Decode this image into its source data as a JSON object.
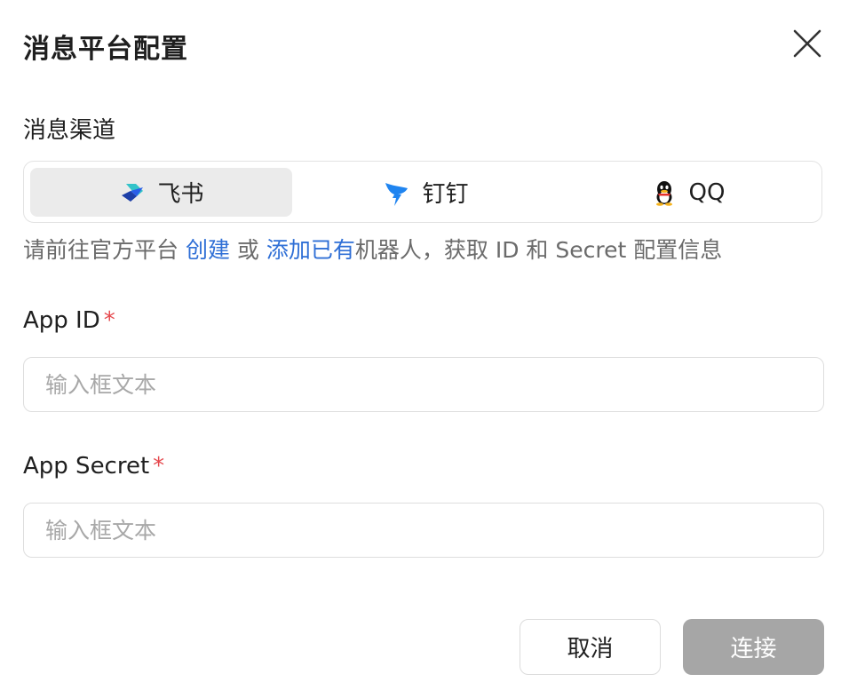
{
  "dialog": {
    "title": "消息平台配置",
    "close_icon": "close-icon"
  },
  "channel": {
    "label": "消息渠道",
    "tabs": [
      {
        "label": "飞书",
        "icon": "feishu-icon",
        "active": true
      },
      {
        "label": "钉钉",
        "icon": "dingtalk-icon",
        "active": false
      },
      {
        "label": "QQ",
        "icon": "qq-icon",
        "active": false
      }
    ]
  },
  "hint": {
    "prefix": "请前往官方平台 ",
    "create_link": "创建",
    "middle": " 或 ",
    "add_link": "添加已有",
    "suffix": "机器人，获取 ID 和 Secret 配置信息"
  },
  "fields": {
    "app_id": {
      "label": "App ID",
      "required_mark": "*",
      "placeholder": "输入框文本",
      "value": ""
    },
    "app_secret": {
      "label": "App Secret",
      "required_mark": "*",
      "placeholder": "输入框文本",
      "value": ""
    }
  },
  "actions": {
    "cancel_label": "取消",
    "connect_label": "连接"
  },
  "colors": {
    "link": "#2f6fd6",
    "required": "#e5484d",
    "connect_disabled": "#a6a6a6",
    "active_tab": "#ebebeb"
  }
}
